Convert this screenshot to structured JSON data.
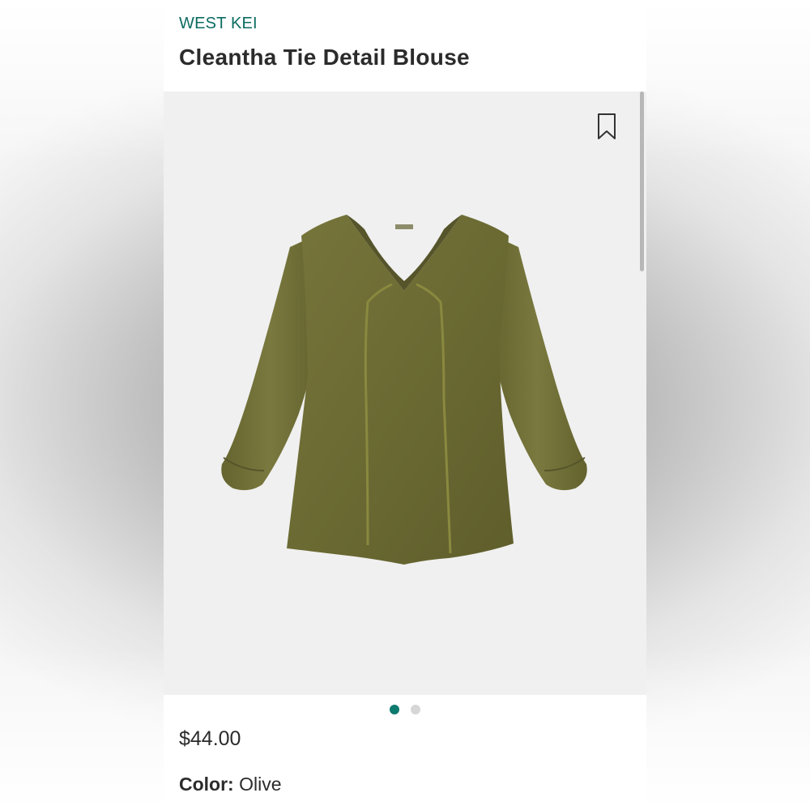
{
  "product": {
    "brand": "WEST KEI",
    "name": "Cleantha Tie Detail Blouse",
    "price": "$44.00",
    "color_label": "Color:",
    "color_value": "Olive",
    "garment_color": "#6b6a33"
  },
  "gallery": {
    "image_icon": "bookmark-icon",
    "pages": 2,
    "active_page": 1
  },
  "colors": {
    "brand": "#0d6b61",
    "active_dot": "#0d7a6e",
    "inactive_dot": "#d6d6d6",
    "image_bg": "#f0f0f0"
  }
}
